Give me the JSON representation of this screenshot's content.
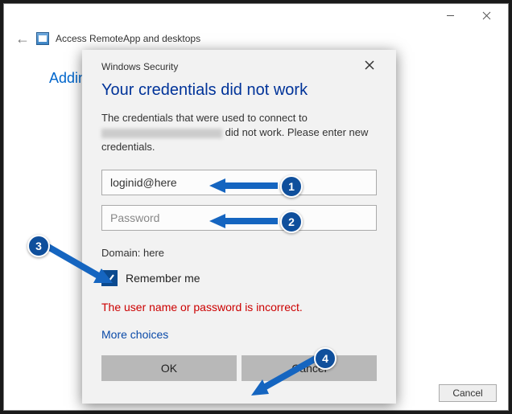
{
  "parent": {
    "title": "Access RemoteApp and desktops",
    "body_link": "Adding",
    "cancel": "Cancel"
  },
  "dialog": {
    "title": "Windows Security",
    "heading": "Your credentials did not work",
    "desc_prefix": "The credentials that were used to connect to ",
    "desc_suffix": " did not work. Please enter new credentials.",
    "username_value": "loginid@here",
    "password_placeholder": "Password",
    "domain_label": "Domain: here",
    "remember_label": "Remember me",
    "error": "The user name or password is incorrect.",
    "more_choices": "More choices",
    "ok_label": "OK",
    "cancel_label": "Cancel"
  },
  "annotations": {
    "n1": "1",
    "n2": "2",
    "n3": "3",
    "n4": "4"
  }
}
